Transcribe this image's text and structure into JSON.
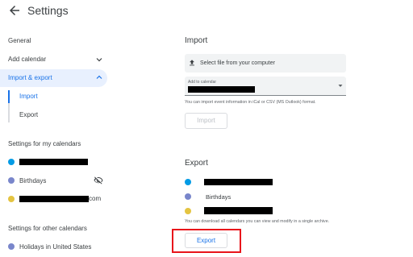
{
  "header": {
    "title": "Settings",
    "back_icon": "arrow-back-icon"
  },
  "sidebar": {
    "general": "General",
    "add_calendar": "Add calendar",
    "import_export": "Import & export",
    "import": "Import",
    "export": "Export",
    "my_calendars_heading": "Settings for my calendars",
    "my_calendars": [
      {
        "label": "",
        "color": "#039be5",
        "redacted": true
      },
      {
        "label": "Birthdays",
        "color": "#7986cb",
        "redacted": false,
        "hidden_icon": "visibility-off-icon"
      },
      {
        "label": "com",
        "color": "#e4c441",
        "redacted": true
      }
    ],
    "other_calendars_heading": "Settings for other calendars",
    "other_calendars": [
      {
        "label": "Holidays in United States",
        "color": "#7986cb"
      }
    ]
  },
  "import_section": {
    "title": "Import",
    "file_label": "Select file from your computer",
    "file_icon": "upload-icon",
    "select_caption": "Add to calendar",
    "select_value": "",
    "hint": "You can import event information in iCal or CSV (MS Outlook) format.",
    "button": "Import"
  },
  "export_section": {
    "title": "Export",
    "calendars": [
      {
        "label": "",
        "color": "#039be5",
        "redacted": true
      },
      {
        "label": "Birthdays",
        "color": "#7986cb",
        "redacted": false
      },
      {
        "label": "",
        "color": "#e4c441",
        "redacted": true
      }
    ],
    "hint": "You can download all calendars you can view and modify in a single archive.",
    "button": "Export"
  },
  "colors": {
    "accent": "#1a73e8",
    "active_bg": "#e8f0fe",
    "highlight": "#e8141b"
  }
}
